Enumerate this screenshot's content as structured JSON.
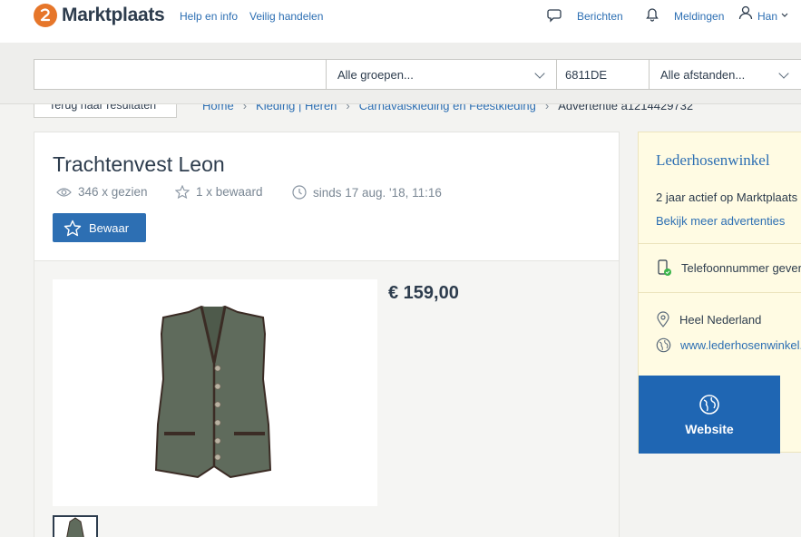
{
  "header": {
    "logo_text": "Marktplaats",
    "links": [
      "Help en info",
      "Veilig handelen"
    ],
    "messages_label": "Berichten",
    "notifications_label": "Meldingen",
    "user_label": "Han"
  },
  "search": {
    "query_value": "",
    "category_select": "Alle groepen...",
    "postcode_value": "6811DE",
    "distance_select": "Alle afstanden..."
  },
  "breadcrumb": {
    "back_label": "Terug naar resultaten",
    "items": [
      "Home",
      "Kleding | Heren",
      "Carnavalskleding en Feestkleding"
    ],
    "current": "Advertentie a1214429732"
  },
  "listing": {
    "title": "Trachtenvest Leon",
    "views": "346 x gezien",
    "saves": "1 x bewaard",
    "since": "sinds 17 aug. '18, 11:16",
    "save_button": "Bewaar",
    "price": "€ 159,00"
  },
  "seller": {
    "name": "Lederhosenwinkel",
    "active": "2 jaar actief op Marktplaats",
    "more_ads": "Bekijk meer advertenties",
    "phone": "Telefoonnummer geverifieerd",
    "location": "Heel Nederland",
    "website_url": "www.lederhosenwinkel.nl",
    "website_button": "Website"
  },
  "colors": {
    "brand_blue": "#2d6fb3",
    "logo_orange": "#e6762a",
    "seller_bg": "#fffbe3",
    "verified_green": "#3bb54a"
  }
}
